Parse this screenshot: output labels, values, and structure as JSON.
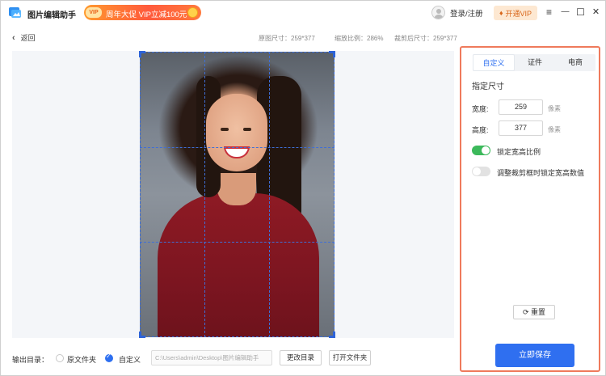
{
  "app": {
    "title": "图片编辑助手",
    "promo": {
      "badge": "VIP",
      "text": "周年大促 VIP立减100元"
    },
    "login_label": "登录/注册",
    "vip_button": "开通VIP",
    "icons": {
      "menu": "≡",
      "minimize": "—",
      "maximize": "☐",
      "close": "✕"
    }
  },
  "toolbar": {
    "back_label": "返回",
    "original_size": "原图尺寸：259*377",
    "zoom_ratio": "缩放比例：286%",
    "cropped_size": "裁剪后尺寸：259*377"
  },
  "bottom": {
    "output_label": "输出目录：",
    "option_original": "原文件夹",
    "option_custom": "自定义",
    "path_value": "C:\\Users\\admin\\Desktop\\图片编辑助手",
    "change_dir_button": "更改目录",
    "open_folder_button": "打开文件夹"
  },
  "panel": {
    "tabs": [
      {
        "label": "自定义",
        "active": true
      },
      {
        "label": "证件",
        "active": false
      },
      {
        "label": "电商",
        "active": false
      }
    ],
    "section_title": "指定尺寸",
    "width_label": "宽度:",
    "width_value": "259",
    "height_label": "高度:",
    "height_value": "377",
    "unit": "像素",
    "lock_ratio_label": "锁定宽高比例",
    "lock_ratio_on": true,
    "lock_dims_label": "调整裁剪框时锁定宽高数值",
    "lock_dims_on": false,
    "reset_button": "重置",
    "save_button": "立即保存"
  },
  "colors": {
    "accent": "#2f6ff0",
    "panel_border": "#ef7a5c",
    "toggle_on": "#3cb95b",
    "crop_guides": "#3f6fd6"
  }
}
